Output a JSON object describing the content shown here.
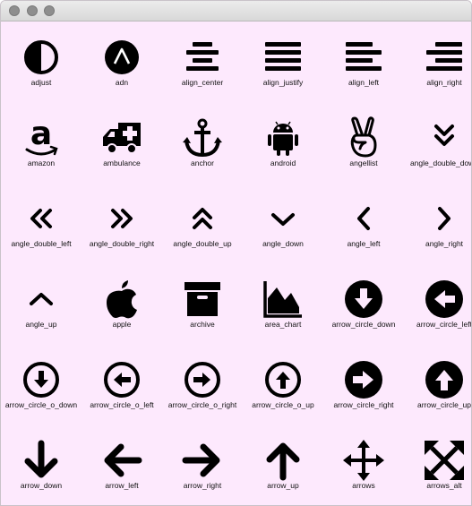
{
  "window": {
    "title": ""
  },
  "icons": [
    {
      "name": "adjust",
      "icon": "adjust-icon"
    },
    {
      "name": "adn",
      "icon": "adn-icon"
    },
    {
      "name": "align_center",
      "icon": "align-center-icon"
    },
    {
      "name": "align_justify",
      "icon": "align-justify-icon"
    },
    {
      "name": "align_left",
      "icon": "align-left-icon"
    },
    {
      "name": "align_right",
      "icon": "align-right-icon"
    },
    {
      "name": "amazon",
      "icon": "amazon-icon"
    },
    {
      "name": "ambulance",
      "icon": "ambulance-icon"
    },
    {
      "name": "anchor",
      "icon": "anchor-icon"
    },
    {
      "name": "android",
      "icon": "android-icon"
    },
    {
      "name": "angellist",
      "icon": "angellist-icon"
    },
    {
      "name": "angle_double_down",
      "icon": "angle-double-down-icon"
    },
    {
      "name": "angle_double_left",
      "icon": "angle-double-left-icon"
    },
    {
      "name": "angle_double_right",
      "icon": "angle-double-right-icon"
    },
    {
      "name": "angle_double_up",
      "icon": "angle-double-up-icon"
    },
    {
      "name": "angle_down",
      "icon": "angle-down-icon"
    },
    {
      "name": "angle_left",
      "icon": "angle-left-icon"
    },
    {
      "name": "angle_right",
      "icon": "angle-right-icon"
    },
    {
      "name": "angle_up",
      "icon": "angle-up-icon"
    },
    {
      "name": "apple",
      "icon": "apple-icon"
    },
    {
      "name": "archive",
      "icon": "archive-icon"
    },
    {
      "name": "area_chart",
      "icon": "area-chart-icon"
    },
    {
      "name": "arrow_circle_down",
      "icon": "arrow-circle-down-icon"
    },
    {
      "name": "arrow_circle_left",
      "icon": "arrow-circle-left-icon"
    },
    {
      "name": "arrow_circle_o_down",
      "icon": "arrow-circle-o-down-icon"
    },
    {
      "name": "arrow_circle_o_left",
      "icon": "arrow-circle-o-left-icon"
    },
    {
      "name": "arrow_circle_o_right",
      "icon": "arrow-circle-o-right-icon"
    },
    {
      "name": "arrow_circle_o_up",
      "icon": "arrow-circle-o-up-icon"
    },
    {
      "name": "arrow_circle_right",
      "icon": "arrow-circle-right-icon"
    },
    {
      "name": "arrow_circle_up",
      "icon": "arrow-circle-up-icon"
    },
    {
      "name": "arrow_down",
      "icon": "arrow-down-icon"
    },
    {
      "name": "arrow_left",
      "icon": "arrow-left-icon"
    },
    {
      "name": "arrow_right",
      "icon": "arrow-right-icon"
    },
    {
      "name": "arrow_up",
      "icon": "arrow-up-icon"
    },
    {
      "name": "arrows",
      "icon": "arrows-icon"
    },
    {
      "name": "arrows_alt",
      "icon": "arrows-alt-icon"
    }
  ],
  "colors": {
    "background": "#fde9fd",
    "icon": "#000000",
    "label": "#111111"
  }
}
